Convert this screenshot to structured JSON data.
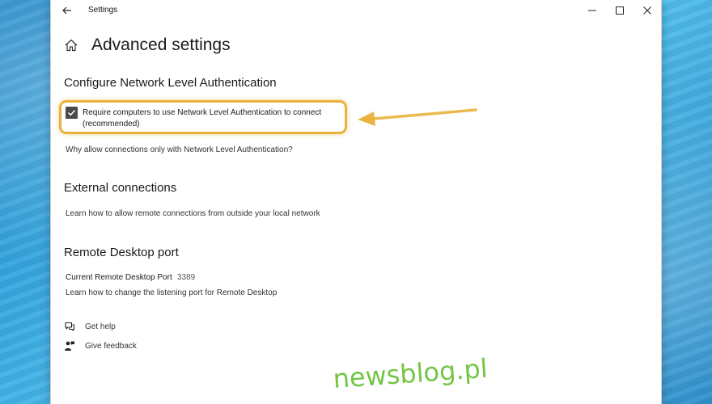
{
  "window": {
    "title": "Settings",
    "controls": [
      "minimize",
      "maximize",
      "close"
    ]
  },
  "page": {
    "title": "Advanced settings"
  },
  "nla": {
    "heading": "Configure Network Level Authentication",
    "checkbox_label": "Require computers to use Network Level Authentication to connect (recommended)",
    "checked": true,
    "link": "Why allow connections only with Network Level Authentication?"
  },
  "external": {
    "heading": "External connections",
    "link": "Learn how to allow remote connections from outside your local network"
  },
  "port": {
    "heading": "Remote Desktop port",
    "label": "Current Remote Desktop Port",
    "value": "3389",
    "link": "Learn how to change the listening port for Remote Desktop"
  },
  "help": {
    "get_help": "Get help",
    "give_feedback": "Give feedback"
  },
  "watermark": "newsblog.pl",
  "colors": {
    "highlight": "#e8b23c",
    "watermark": "#6dc23b",
    "checkbox": "#4a4a4a"
  },
  "icons": [
    "back-arrow-icon",
    "home-icon",
    "minimize-icon",
    "maximize-icon",
    "close-icon",
    "checkmark-icon",
    "help-chat-icon",
    "feedback-icon",
    "pointer-arrow-icon"
  ]
}
